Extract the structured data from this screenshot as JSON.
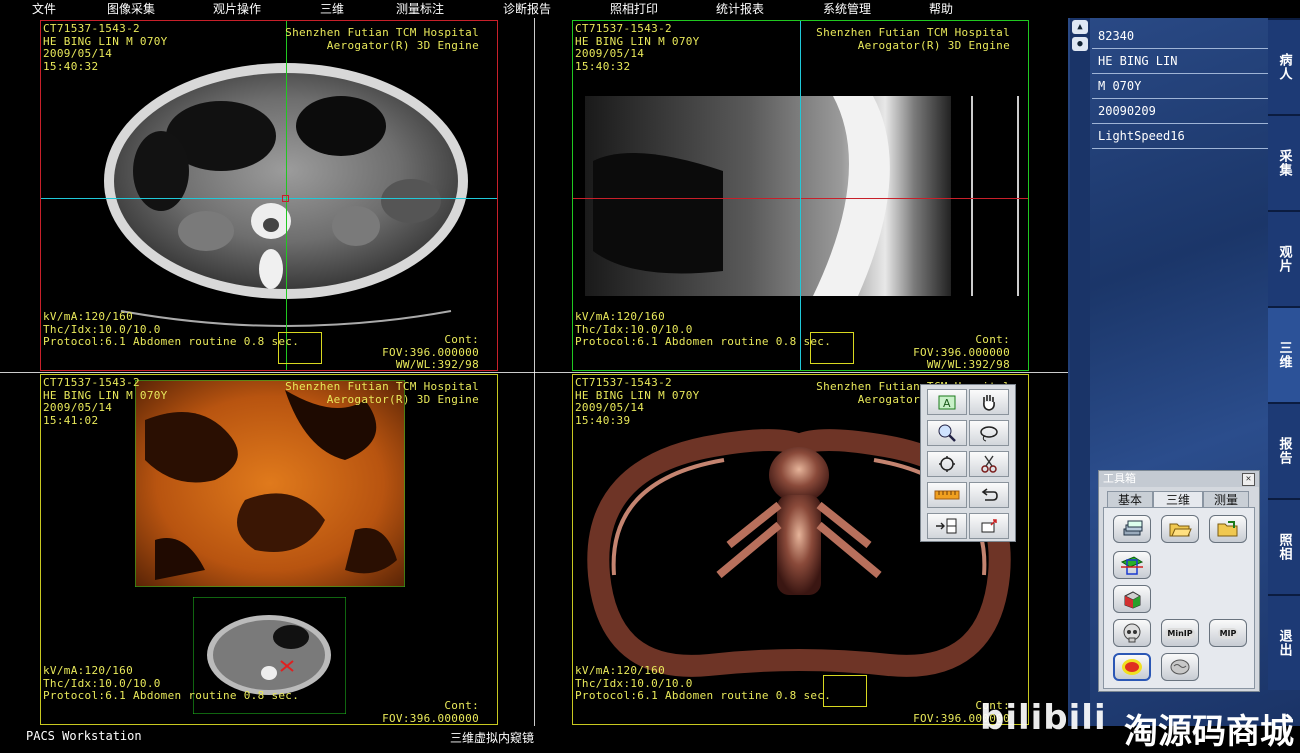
{
  "menu": [
    "文件",
    "图像采集",
    "观片操作",
    "三维",
    "测量标注",
    "诊断报告",
    "照相打印",
    "统计报表",
    "系统管理",
    "帮助"
  ],
  "viewports": {
    "tl": {
      "id": "CT71537-1543-2",
      "patient": "HE BING LIN M 070Y",
      "date": "2009/05/14",
      "time": "15:40:32",
      "hospital": "Shenzhen Futian TCM Hospital",
      "engine": "Aerogator(R) 3D Engine",
      "kv": "kV/mA:120/160",
      "thc": "Thc/Idx:10.0/10.0",
      "protocol": "Protocol:6.1 Abdomen routine 0.8 sec.",
      "cont": "Cont:",
      "fov": "FOV:396.000000",
      "wwwl": "WW/WL:392/98"
    },
    "tr": {
      "id": "CT71537-1543-2",
      "patient": "HE BING LIN M 070Y",
      "date": "2009/05/14",
      "time": "15:40:32",
      "hospital": "Shenzhen Futian TCM Hospital",
      "engine": "Aerogator(R) 3D Engine",
      "kv": "kV/mA:120/160",
      "thc": "Thc/Idx:10.0/10.0",
      "protocol": "Protocol:6.1 Abdomen routine 0.8 sec.",
      "cont": "Cont:",
      "fov": "FOV:396.000000",
      "wwwl": "WW/WL:392/98"
    },
    "bl": {
      "id": "CT71537-1543-2",
      "patient": "HE BING LIN M 070Y",
      "date": "2009/05/14",
      "time": "15:41:02",
      "hospital": "Shenzhen Futian TCM Hospital",
      "engine": "Aerogator(R) 3D Engine",
      "kv": "kV/mA:120/160",
      "thc": "Thc/Idx:10.0/10.0",
      "protocol": "Protocol:6.1 Abdomen routine 0.8 sec.",
      "cont": "Cont:",
      "fov": "FOV:396.000000"
    },
    "br": {
      "id": "CT71537-1543-2",
      "patient": "HE BING LIN M 070Y",
      "date": "2009/05/14",
      "time": "15:40:39",
      "hospital": "Shenzhen Futian TCM Hospital",
      "engine": "Aerogator(R) 3D Engine",
      "kv": "kV/mA:120/160",
      "thc": "Thc/Idx:10.0/10.0",
      "protocol": "Protocol:6.1 Abdomen routine 0.8 sec.",
      "cont": "Cont:",
      "fov": "FOV:396.000000"
    }
  },
  "status": {
    "left": "PACS Workstation",
    "center": "三维虚拟内窥镜"
  },
  "patient_info": [
    "82340",
    "HE BING LIN",
    "M 070Y",
    "20090209",
    "LightSpeed16"
  ],
  "side_tabs": [
    "病人",
    "采集",
    "观片",
    "三维",
    "报告",
    "照相",
    "退出"
  ],
  "active_tab": "三维",
  "toolbox": {
    "title": "工具箱",
    "tabs": [
      "基本",
      "三维",
      "测量"
    ],
    "active_tab": "三维",
    "buttons": {
      "minip": "MinIP",
      "mip": "MIP"
    }
  },
  "watermark": {
    "brand": "bilibili",
    "text": "淘源码商城"
  },
  "colors": {
    "yellow_frame": "#c8c820",
    "red_frame": "#c8202a",
    "green_frame": "#20c820",
    "cyan_line": "#20c8d8",
    "panel_blue": "#1d3a75"
  }
}
